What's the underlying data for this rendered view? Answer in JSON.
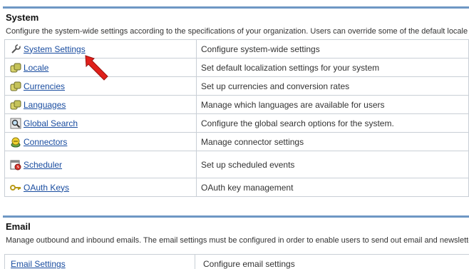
{
  "system": {
    "title": "System",
    "description": "Configure the system-wide settings according to the specifications of your organization. Users can override some of the default locale s",
    "rows": [
      {
        "label": "System Settings",
        "description": "Configure system-wide settings",
        "icon": "wrench-icon"
      },
      {
        "label": "Locale",
        "description": "Set default localization settings for your system",
        "icon": "locale-icon"
      },
      {
        "label": "Currencies",
        "description": "Set up currencies and conversion rates",
        "icon": "currencies-icon"
      },
      {
        "label": "Languages",
        "description": "Manage which languages are available for users",
        "icon": "languages-icon"
      },
      {
        "label": "Global Search",
        "description": "Configure the global search options for the system.",
        "icon": "global-search-icon"
      },
      {
        "label": "Connectors",
        "description": "Manage connector settings",
        "icon": "connectors-icon"
      },
      {
        "label": "Scheduler",
        "description": "Set up scheduled events",
        "icon": "scheduler-icon"
      },
      {
        "label": "OAuth Keys",
        "description": "OAuth key management",
        "icon": "key-icon"
      }
    ]
  },
  "email": {
    "title": "Email",
    "description": "Manage outbound and inbound emails. The email settings must be configured in order to enable users to send out email and newsletter",
    "first_row": {
      "label": "Email Settings",
      "description": "Configure email settings"
    }
  },
  "colors": {
    "panel_border": "#6e97c4",
    "link": "#1a4da0",
    "arrow": "#e0201b"
  }
}
